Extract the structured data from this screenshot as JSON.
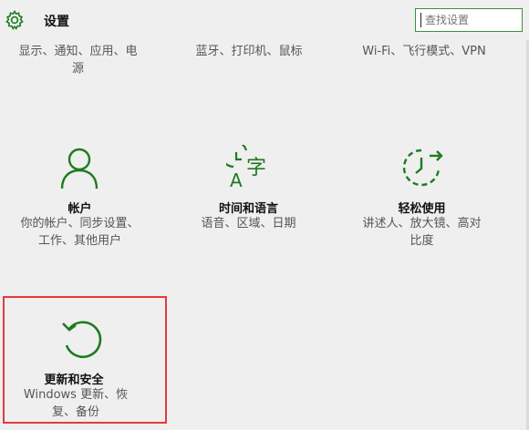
{
  "header": {
    "title": "设置",
    "search_placeholder": "查找设置"
  },
  "top_row": [
    {
      "line1": "显示、通知、应用、电",
      "line2": "源"
    },
    {
      "line1": "蓝牙、打印机、鼠标",
      "line2": ""
    },
    {
      "line1": "Wi-Fi、飞行模式、VPN",
      "line2": ""
    }
  ],
  "tiles": [
    {
      "name": "帐户",
      "desc1": "你的帐户、同步设置、",
      "desc2": "工作、其他用户",
      "icon": "person-icon"
    },
    {
      "name": "时间和语言",
      "desc1": "语音、区域、日期",
      "desc2": "",
      "icon": "time-language-icon"
    },
    {
      "name": "轻松使用",
      "desc1": "讲述人、放大镜、高对",
      "desc2": "比度",
      "icon": "ease-of-access-icon"
    },
    {
      "name": "更新和安全",
      "desc1": "Windows 更新、恢",
      "desc2": "复、备份",
      "icon": "update-icon"
    }
  ],
  "colors": {
    "accent": "#1f7a1f",
    "highlight_border": "#e23b3b",
    "background": "#efefef"
  }
}
